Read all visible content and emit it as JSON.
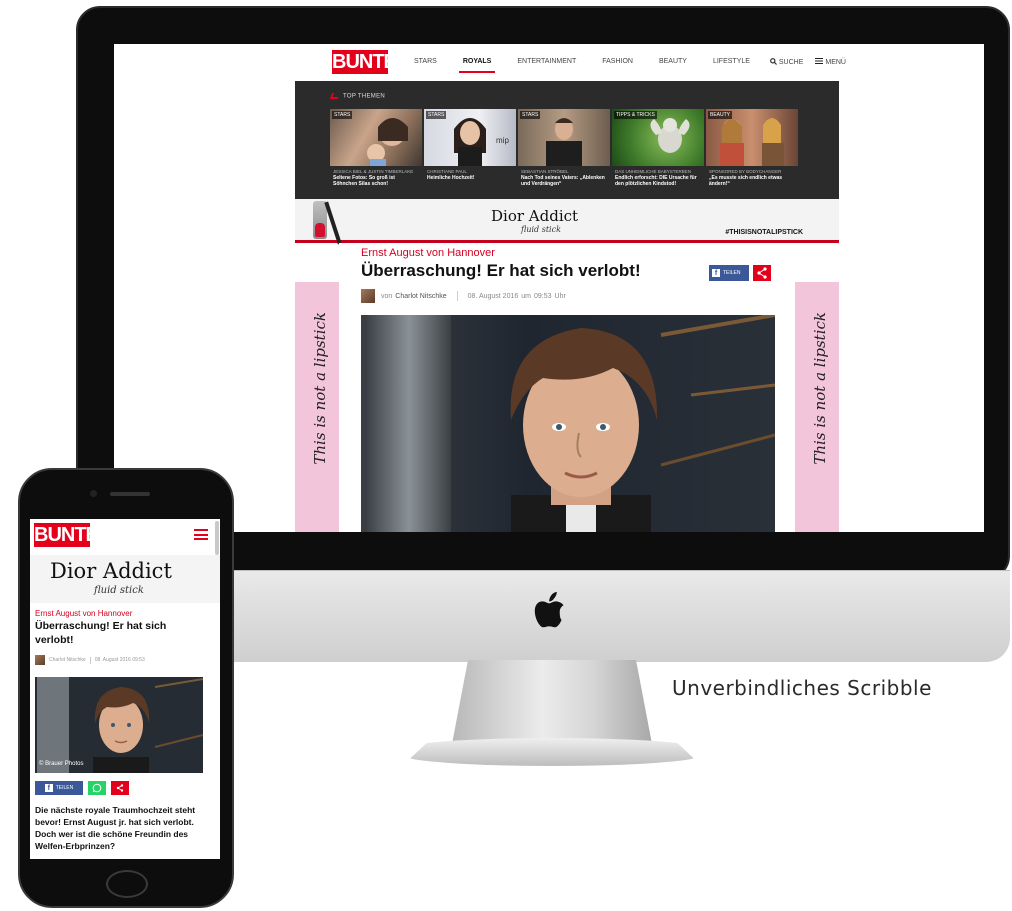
{
  "caption": "Unverbindliches Scribble",
  "desktop": {
    "logo": "BUNTE",
    "nav": [
      {
        "label": "STARS",
        "active": false
      },
      {
        "label": "ROYALS",
        "active": true
      },
      {
        "label": "ENTERTAINMENT",
        "active": false
      },
      {
        "label": "FASHION",
        "active": false
      },
      {
        "label": "BEAUTY",
        "active": false
      },
      {
        "label": "LIFESTYLE",
        "active": false
      }
    ],
    "search_label": "SUCHE",
    "menu_label": "MENÜ",
    "top_themen_label": "TOP THEMEN",
    "cards": [
      {
        "tag": "STARS",
        "kicker": "JESSICA BIEL & JUSTIN TIMBERLAKE",
        "title": "Seltene Fotos: So groß ist Söhnchen Silas schon!"
      },
      {
        "tag": "STARS",
        "kicker": "CHRISTIANE PAUL",
        "title": "Heimliche Hochzeit!"
      },
      {
        "tag": "STARS",
        "kicker": "SEBASTIAN STRÖBEL",
        "title": "Nach Tod seines Vaters: „Ablenken und Verdrängen“"
      },
      {
        "tag": "TIPPS & TRICKS",
        "kicker": "DAS UNHEIMLICHE BABYSTERBEN",
        "title": "Endlich erforscht: DIE Ursache für den plötzlichen Kindstod!"
      },
      {
        "tag": "BEAUTY",
        "kicker": "SPONSORED BY BODYCHANGER",
        "title": "„Es musste sich endlich etwas ändern!“"
      }
    ],
    "ad": {
      "brand": "Dior Addict",
      "sub": "fluid stick",
      "hashtag": "#THISISNOTALIPSTICK",
      "side_text": "This is not a lipstick"
    },
    "article": {
      "kicker": "Ernst August von Hannover",
      "headline": "Überraschung! Er hat sich verlobt!",
      "share_label": "TEILEN",
      "author_prefix": "von",
      "author": "Charlot Nitschke",
      "date": "08. August 2016",
      "time_prefix": "um",
      "time": "09:53",
      "time_suffix": "Uhr"
    }
  },
  "mobile": {
    "logo": "BUNTE",
    "ad": {
      "brand": "Dior Addict",
      "sub": "fluid stick"
    },
    "kicker": "Ernst August von Hannover",
    "headline": "Überraschung! Er hat sich verlobt!",
    "author": "Charlot Nitschke",
    "datetime": "08. August 2016 09:53",
    "photo_credit": "© Brauer Photos",
    "share_label": "TEILEN",
    "teaser": "Die nächste royale Traumhochzeit steht bevor! Ernst August jr. hat sich verlobt. Doch wer ist die schöne Freundin des Welfen-Erbprinzen?"
  },
  "colors": {
    "brand_red": "#e3001b",
    "facebook_blue": "#3b5998",
    "whatsapp_green": "#25d366",
    "ad_pink": "#f3c5db"
  }
}
